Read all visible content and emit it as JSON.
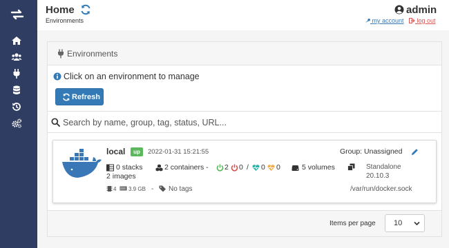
{
  "header": {
    "title": "Home",
    "breadcrumb": "Environments",
    "username": "admin",
    "my_account": "my account",
    "log_out": "log out"
  },
  "sidebar": {
    "items": [
      {
        "icon": "home-icon"
      },
      {
        "icon": "users-icon"
      },
      {
        "icon": "plug-icon"
      },
      {
        "icon": "database-icon"
      },
      {
        "icon": "history-icon"
      },
      {
        "icon": "cogs-icon"
      }
    ]
  },
  "environments": {
    "title": "Environments",
    "info_text": "Click on an environment to manage",
    "refresh_label": "Refresh",
    "search_placeholder": "Search by name, group, tag, status, URL...",
    "items_per_page_label": "Items per page",
    "items_per_page_value": "10",
    "items": [
      {
        "name": "local",
        "status": "up",
        "timestamp": "2022-01-31 15:21:55",
        "group": "Group: Unassigned",
        "stacks": "0 stacks",
        "containers": "2 containers -",
        "running": "2",
        "stopped": "0",
        "slash": "/",
        "healthy": "0",
        "unhealthy": "0",
        "volumes": "5 volumes",
        "images": "2 images",
        "mode": "Standalone",
        "version": "20.10.3",
        "cpu": "4",
        "memory": "3.9 GB",
        "dash": "-",
        "tags": "No tags",
        "url": "/var/run/docker.sock"
      }
    ]
  },
  "colors": {
    "sidebar_bg": "#2f3d63",
    "primary": "#337ab7",
    "success": "#5cb85c",
    "danger": "#d9534f",
    "docker_blue": "#3a77b6",
    "heart_healthy": "#2bb3a8",
    "heart_unhealthy": "#f0ad4e"
  }
}
